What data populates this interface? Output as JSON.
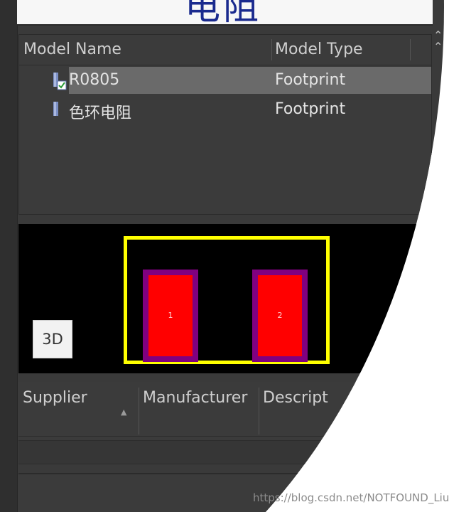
{
  "symbol_preview": {
    "text": "电阻"
  },
  "models": {
    "columns": [
      "Model Name",
      "Model Type"
    ],
    "rows": [
      {
        "name": "R0805",
        "type": "Footprint",
        "icon": "footprint-model-icon",
        "selected": true,
        "current": true
      },
      {
        "name": "色环电阻",
        "type": "Footprint",
        "icon": "footprint-model-icon",
        "selected": false,
        "current": false
      }
    ]
  },
  "footprint_preview": {
    "pads": [
      "1",
      "2"
    ],
    "button_3d": "3D",
    "colors": {
      "background": "#000000",
      "outline": "#ffff00",
      "pad_fill": "#ff0000",
      "pad_border": "#800080"
    }
  },
  "suppliers": {
    "columns": [
      "Supplier",
      "Manufacturer",
      "Descript"
    ],
    "sort_icon": "sort-ascending-icon"
  },
  "watermark": "https://blog.csdn.net/NOTFOUND_Liu",
  "colors": {
    "panel": "#3a3a3a",
    "selected_row": "#6a6a6a",
    "symbol_text": "#1a2a8e"
  }
}
